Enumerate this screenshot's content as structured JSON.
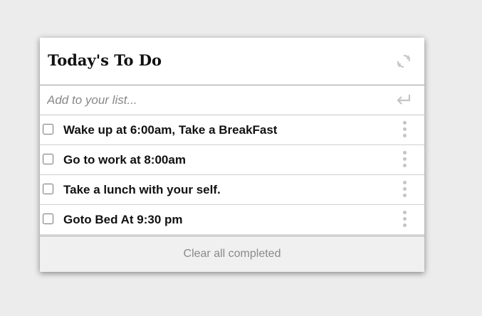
{
  "header": {
    "title": "Today's To Do",
    "refresh_icon": "refresh-icon"
  },
  "add": {
    "placeholder": "Add to your list...",
    "value": "",
    "enter_icon": "enter-return-icon"
  },
  "items": [
    {
      "label": "Wake up at 6:00am, Take a BreakFast",
      "checked": false
    },
    {
      "label": "Go to work at 8:00am",
      "checked": false
    },
    {
      "label": "Take a lunch with your self.",
      "checked": false
    },
    {
      "label": "Goto Bed At 9:30 pm",
      "checked": false
    }
  ],
  "footer": {
    "clear_label": "Clear all completed"
  },
  "colors": {
    "background": "#ececec",
    "card": "#ffffff",
    "footer": "#f0f0f0",
    "muted_text": "#8a8a8a",
    "icon_gray": "#c4c4c4"
  }
}
